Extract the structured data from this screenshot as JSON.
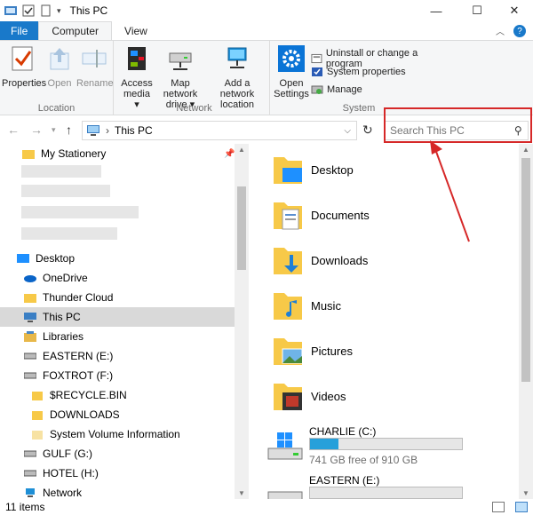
{
  "window": {
    "title": "This PC",
    "minimize_glyph": "—",
    "maximize_glyph": "☐",
    "close_glyph": "✕"
  },
  "ribbon_tabs": [
    {
      "label": "File"
    },
    {
      "label": "Computer"
    },
    {
      "label": "View"
    }
  ],
  "ribbon": {
    "groups": {
      "location": "Location",
      "network": "Network",
      "system": "System"
    },
    "buttons": {
      "properties": "Properties",
      "open": "Open",
      "rename": "Rename",
      "access_media_1": "Access",
      "access_media_2": "media ▾",
      "map_network_1": "Map network",
      "map_network_2": "drive ▾",
      "add_network_1": "Add a network",
      "add_network_2": "location",
      "open_settings_1": "Open",
      "open_settings_2": "Settings",
      "uninstall": "Uninstall or change a program",
      "system_properties": "System properties",
      "manage": "Manage"
    }
  },
  "address": {
    "path": "This PC",
    "separator": "›"
  },
  "search": {
    "placeholder": "Search This PC"
  },
  "nav": {
    "items": [
      {
        "label": "My Stationery"
      },
      {
        "label": "Desktop"
      },
      {
        "label": "OneDrive"
      },
      {
        "label": "Thunder Cloud"
      },
      {
        "label": "This PC"
      },
      {
        "label": "Libraries"
      },
      {
        "label": "EASTERN (E:)"
      },
      {
        "label": "FOXTROT (F:)"
      },
      {
        "label": "$RECYCLE.BIN"
      },
      {
        "label": "DOWNLOADS"
      },
      {
        "label": "System Volume Information"
      },
      {
        "label": "GULF (G:)"
      },
      {
        "label": "HOTEL (H:)"
      },
      {
        "label": "Network"
      }
    ]
  },
  "content": {
    "folders": [
      {
        "label": "Desktop"
      },
      {
        "label": "Documents"
      },
      {
        "label": "Downloads"
      },
      {
        "label": "Music"
      },
      {
        "label": "Pictures"
      },
      {
        "label": "Videos"
      }
    ],
    "drives": [
      {
        "label": "CHARLIE (C:)",
        "free": "741 GB free of 910 GB",
        "used_fraction": 0.186
      },
      {
        "label": "EASTERN (E:)"
      }
    ]
  },
  "status": {
    "items": "11 items"
  },
  "colors": {
    "accent": "#1979ca",
    "drive_bar": "#26a0da",
    "highlight": "#d62828",
    "folder": "#f7c948"
  }
}
